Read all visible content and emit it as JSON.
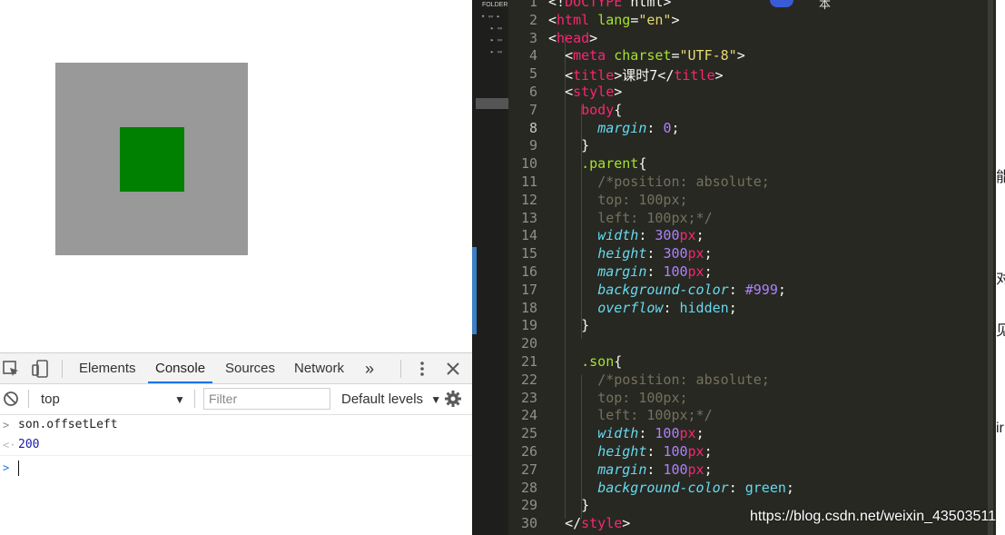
{
  "page": {
    "parent_box_color": "#999999",
    "son_box_color": "#008000"
  },
  "devtools": {
    "tabs": [
      {
        "label": "Elements",
        "active": false
      },
      {
        "label": "Console",
        "active": true
      },
      {
        "label": "Sources",
        "active": false
      },
      {
        "label": "Network",
        "active": false
      }
    ],
    "more_tabs_label": "»",
    "context": "top",
    "filter_placeholder": "Filter",
    "levels_label": "Default levels",
    "console": {
      "input_line": "son.offsetLeft",
      "result_line": "200"
    },
    "accent": "#1a73e8"
  },
  "editor": {
    "sidebar_label": "FOLDER",
    "header_text": "本",
    "current_line": 8,
    "lines": [
      {
        "n": "1",
        "html": "<span class='t-pl'>&lt;!</span><span class='t-tag'>DOCTYPE</span> <span class='t-pl'>html&gt;</span>"
      },
      {
        "n": "2",
        "html": "<span class='t-pl'>&lt;</span><span class='t-tag'>html</span> <span class='t-attr'>lang</span><span class='t-pl'>=</span><span class='t-str'>\"en\"</span><span class='t-pl'>&gt;</span>"
      },
      {
        "n": "3",
        "html": "<span class='t-pl'>&lt;</span><span class='t-tag'>head</span><span class='t-pl'>&gt;</span>"
      },
      {
        "n": "4",
        "html": "  <span class='t-pl'>&lt;</span><span class='t-tag'>meta</span> <span class='t-attr'>charset</span><span class='t-pl'>=</span><span class='t-str'>\"UTF-8\"</span><span class='t-pl'>&gt;</span>"
      },
      {
        "n": "5",
        "html": "  <span class='t-pl'>&lt;</span><span class='t-tag'>title</span><span class='t-pl'>&gt;课时7&lt;/</span><span class='t-tag'>title</span><span class='t-pl'>&gt;</span>"
      },
      {
        "n": "6",
        "html": "  <span class='t-pl'>&lt;</span><span class='t-tag'>style</span><span class='t-pl'>&gt;</span>"
      },
      {
        "n": "7",
        "html": "    <span class='t-tag'>body</span><span class='t-pl'>{</span>"
      },
      {
        "n": "8",
        "html": "      <span class='t-prop'>margin</span><span class='t-pl'>: </span><span class='t-num'>0</span><span class='t-pl'>;</span>"
      },
      {
        "n": "9",
        "html": "    <span class='t-pl'>}</span>"
      },
      {
        "n": "10",
        "html": "    <span class='t-cls'>.parent</span><span class='t-pl'>{</span>"
      },
      {
        "n": "11",
        "html": "      <span class='t-com'>/*position: absolute;</span>"
      },
      {
        "n": "12",
        "html": "      <span class='t-com'>top: 100px;</span>"
      },
      {
        "n": "13",
        "html": "      <span class='t-com'>left: 100px;*/</span>"
      },
      {
        "n": "14",
        "html": "      <span class='t-prop'>width</span><span class='t-pl'>: </span><span class='t-num'>300</span><span class='t-unit'>px</span><span class='t-pl'>;</span>"
      },
      {
        "n": "15",
        "html": "      <span class='t-prop'>height</span><span class='t-pl'>: </span><span class='t-num'>300</span><span class='t-unit'>px</span><span class='t-pl'>;</span>"
      },
      {
        "n": "16",
        "html": "      <span class='t-prop'>margin</span><span class='t-pl'>: </span><span class='t-num'>100</span><span class='t-unit'>px</span><span class='t-pl'>;</span>"
      },
      {
        "n": "17",
        "html": "      <span class='t-prop'>background-color</span><span class='t-pl'>: </span><span class='t-num'>#999</span><span class='t-pl'>;</span>"
      },
      {
        "n": "18",
        "html": "      <span class='t-prop'>overflow</span><span class='t-pl'>: </span><span class='t-val'>hidden</span><span class='t-pl'>;</span>"
      },
      {
        "n": "19",
        "html": "    <span class='t-pl'>}</span>"
      },
      {
        "n": "20",
        "html": ""
      },
      {
        "n": "21",
        "html": "    <span class='t-cls'>.son</span><span class='t-pl'>{</span>"
      },
      {
        "n": "22",
        "html": "      <span class='t-com'>/*position: absolute;</span>"
      },
      {
        "n": "23",
        "html": "      <span class='t-com'>top: 100px;</span>"
      },
      {
        "n": "24",
        "html": "      <span class='t-com'>left: 100px;*/</span>"
      },
      {
        "n": "25",
        "html": "      <span class='t-prop'>width</span><span class='t-pl'>: </span><span class='t-num'>100</span><span class='t-unit'>px</span><span class='t-pl'>;</span>"
      },
      {
        "n": "26",
        "html": "      <span class='t-prop'>height</span><span class='t-pl'>: </span><span class='t-num'>100</span><span class='t-unit'>px</span><span class='t-pl'>;</span>"
      },
      {
        "n": "27",
        "html": "      <span class='t-prop'>margin</span><span class='t-pl'>: </span><span class='t-num'>100</span><span class='t-unit'>px</span><span class='t-pl'>;</span>"
      },
      {
        "n": "28",
        "html": "      <span class='t-prop'>background-color</span><span class='t-pl'>: </span><span class='t-val'>green</span><span class='t-pl'>;</span>"
      },
      {
        "n": "29",
        "html": "    <span class='t-pl'>}</span>"
      },
      {
        "n": "30",
        "html": "  <span class='t-pl'>&lt;/</span><span class='t-tag'>style</span><span class='t-pl'>&gt;</span>"
      }
    ]
  },
  "sliver_chars": [
    "能",
    "对",
    "见",
    "ir"
  ],
  "watermark": "https://blog.csdn.net/weixin_43503511"
}
